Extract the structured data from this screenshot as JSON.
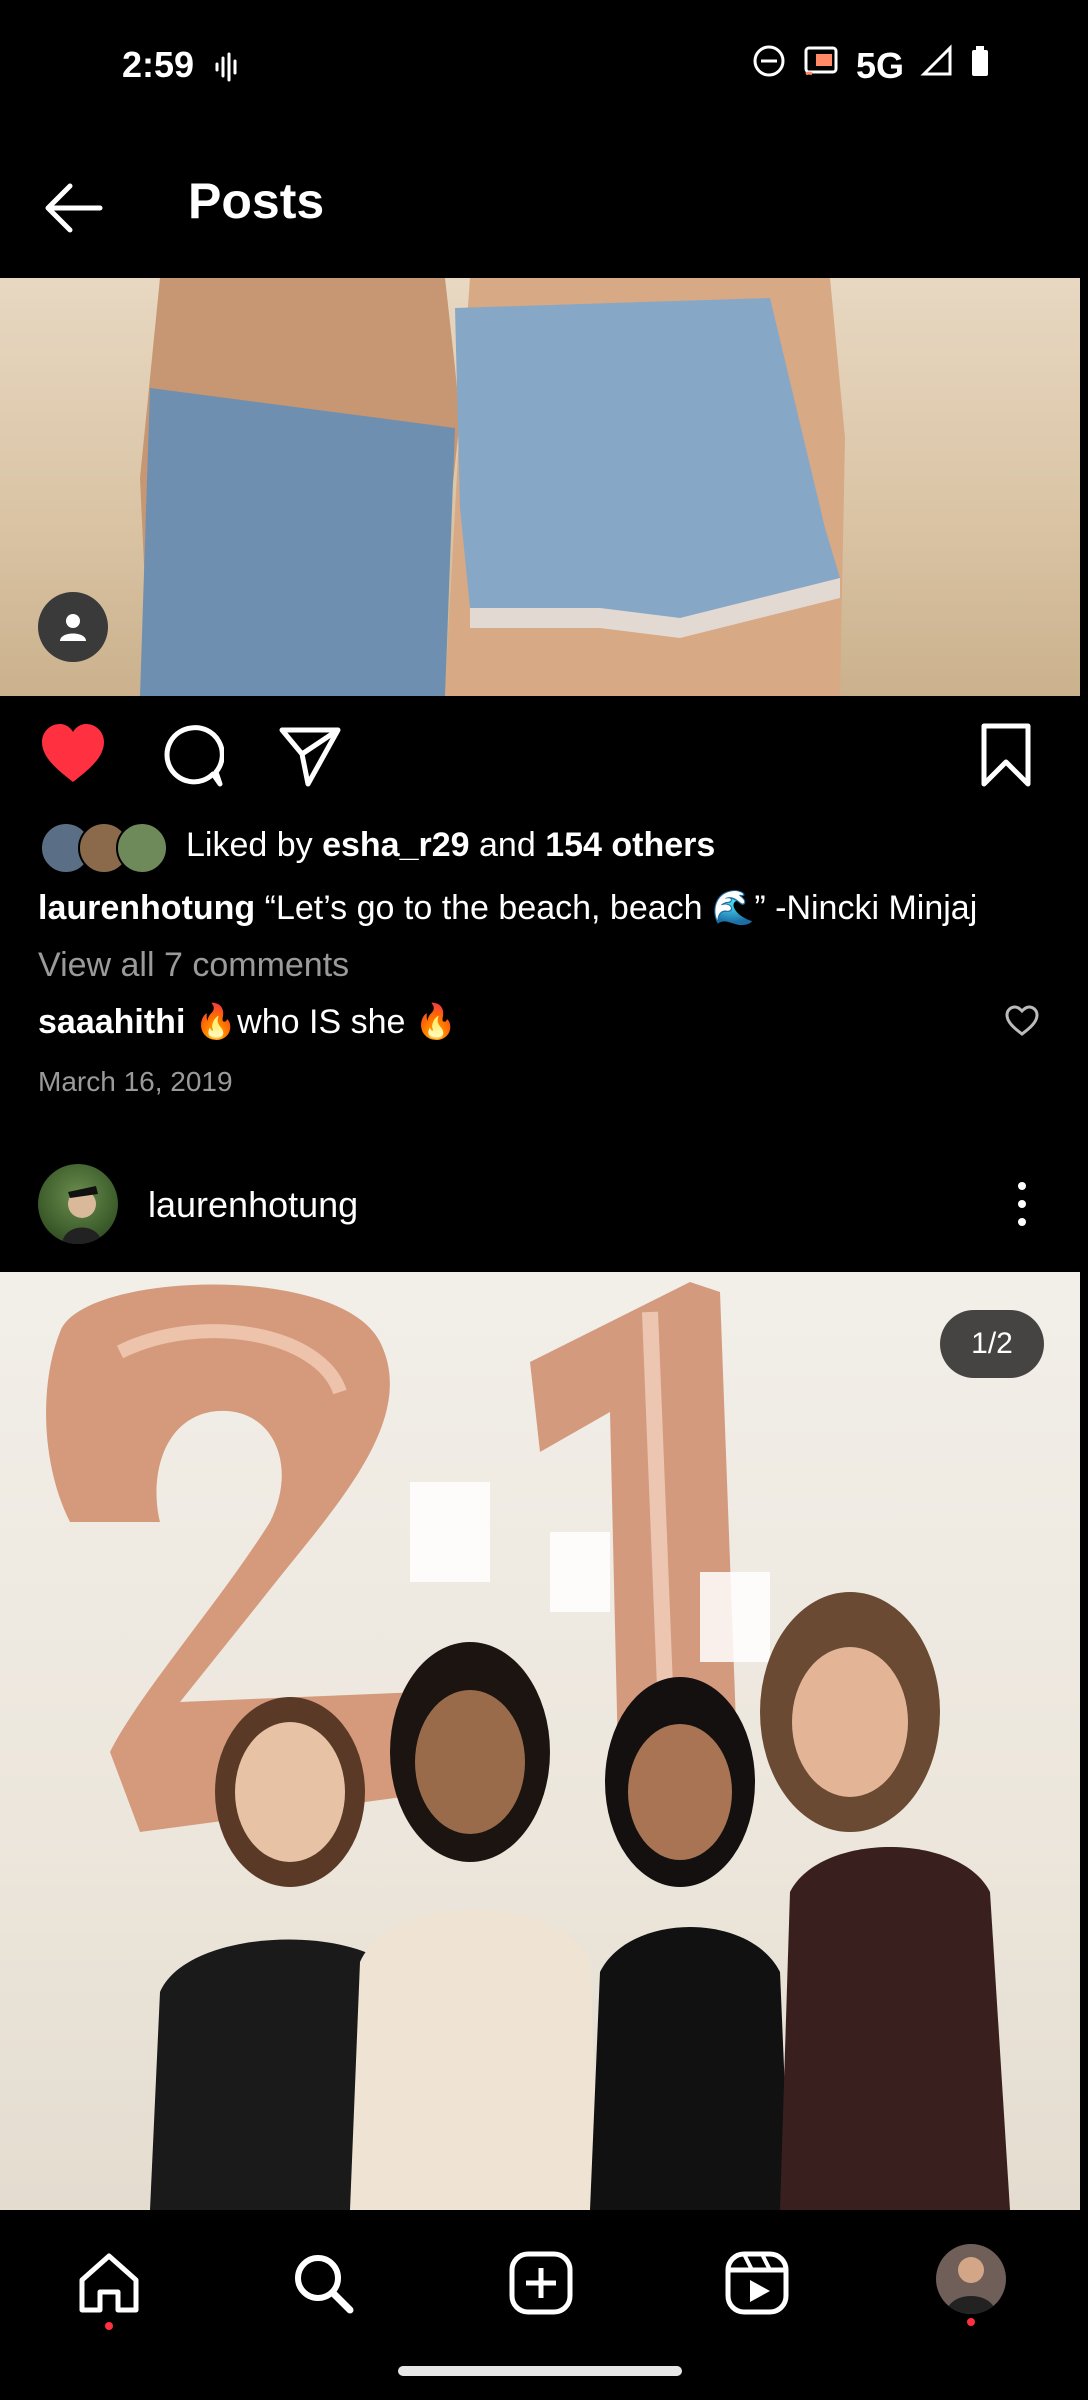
{
  "status_bar": {
    "time": "2:59",
    "network": "5G"
  },
  "header": {
    "title": "Posts"
  },
  "post1": {
    "liked_by_prefix": "Liked by ",
    "liked_by_user": "esha_r29",
    "liked_by_middle": " and ",
    "liked_by_others": "154 others",
    "caption_user": "laurenhotung",
    "caption_text": "“Let’s go to the beach, beach 🌊” -Nincki Minjaj",
    "view_comments": "View all 7 comments",
    "comment_user": "saaahithi",
    "comment_text": "🔥who IS she 🔥",
    "date": "March 16, 2019",
    "liked": true
  },
  "post2": {
    "username": "laurenhotung",
    "slide_counter": "1/2"
  },
  "colors": {
    "background": "#000000",
    "like_red": "#ff3040",
    "muted_text": "#9a9a9a"
  },
  "icons": [
    "back-arrow-icon",
    "heart-icon",
    "comment-icon",
    "share-icon",
    "bookmark-icon",
    "more-icon",
    "home-icon",
    "search-icon",
    "create-icon",
    "reels-icon"
  ]
}
